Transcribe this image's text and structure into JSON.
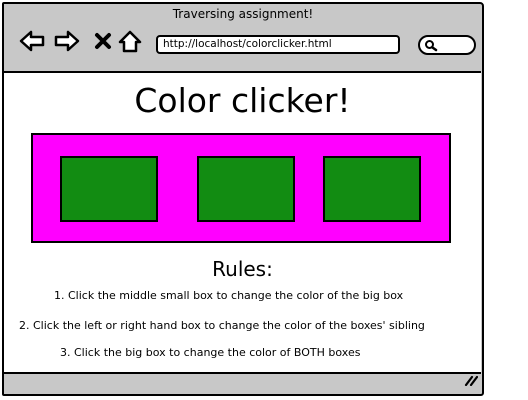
{
  "window": {
    "title": "Traversing assignment!"
  },
  "toolbar": {
    "back_icon": "back-arrow-icon",
    "forward_icon": "forward-arrow-icon",
    "stop_icon": "close-icon",
    "home_icon": "home-icon",
    "url": "http://localhost/colorclicker.html",
    "search_icon": "search-icon"
  },
  "page": {
    "title": "Color clicker!",
    "big_box": {
      "color": "#ff00ff"
    },
    "small_boxes": [
      {
        "position": "left",
        "color": "#128c12"
      },
      {
        "position": "middle",
        "color": "#128c12"
      },
      {
        "position": "right",
        "color": "#128c12"
      }
    ],
    "rules_heading": "Rules:",
    "rules": [
      "1.  Click the middle small box to change the color of the big box",
      "2.  Click the left or right hand box to change the color of the boxes' sibling",
      "3.  Click the big box to change the color of BOTH boxes"
    ]
  },
  "statusbar": {
    "grip_icon": "resize-grip-icon"
  },
  "colors": {
    "chrome": "#c8c8c8",
    "content_bg": "#ffffff"
  }
}
